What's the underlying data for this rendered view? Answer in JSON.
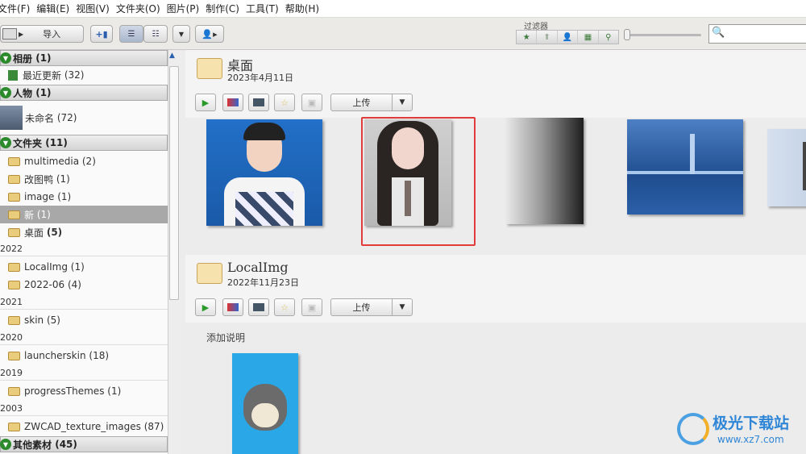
{
  "menu": [
    "文件(F)",
    "编辑(E)",
    "视图(V)",
    "文件夹(O)",
    "图片(P)",
    "制作(C)",
    "工具(T)",
    "帮助(H)"
  ],
  "toolbar": {
    "import_label": "导入",
    "filter_label": "过滤器"
  },
  "sidebar": {
    "albums": {
      "label": "相册",
      "count": "(1)",
      "items": [
        {
          "label": "最近更新",
          "count": "(32)"
        }
      ]
    },
    "people": {
      "label": "人物",
      "count": "(1)",
      "items": [
        {
          "label": "未命名",
          "count": "(72)"
        }
      ]
    },
    "folders": {
      "label": "文件夹",
      "count": "(11)",
      "items": [
        {
          "label": "multimedia",
          "count": "(2)"
        },
        {
          "label": "改图鸭",
          "count": "(1)"
        },
        {
          "label": "image",
          "count": "(1)"
        },
        {
          "label": "新",
          "count": "(1)"
        },
        {
          "label": "桌面",
          "count": "(5)"
        }
      ]
    },
    "years": [
      {
        "year": "2022",
        "items": [
          {
            "label": "LocalImg",
            "count": "(1)"
          },
          {
            "label": "2022-06",
            "count": "(4)"
          }
        ]
      },
      {
        "year": "2021",
        "items": [
          {
            "label": "skin",
            "count": "(5)"
          }
        ]
      },
      {
        "year": "2020",
        "items": [
          {
            "label": "launcherskin",
            "count": "(18)"
          }
        ]
      },
      {
        "year": "2019",
        "items": [
          {
            "label": "progressThemes",
            "count": "(1)"
          }
        ]
      },
      {
        "year": "2003",
        "items": [
          {
            "label": "ZWCAD_texture_images",
            "count": "(87)"
          }
        ]
      }
    ],
    "other": {
      "label": "其他素材",
      "count": "(45)"
    }
  },
  "sections": [
    {
      "title": "桌面",
      "date": "2023年4月11日",
      "upload_label": "上传"
    },
    {
      "title": "LocalImg",
      "date": "2022年11月23日",
      "upload_label": "上传",
      "caption": "添加说明"
    }
  ],
  "watermark": {
    "text": "极光下载站",
    "url": "www.xz7.com"
  },
  "colors": {
    "highlight": "#e23b3b",
    "accent_green": "#2c8a2c"
  }
}
